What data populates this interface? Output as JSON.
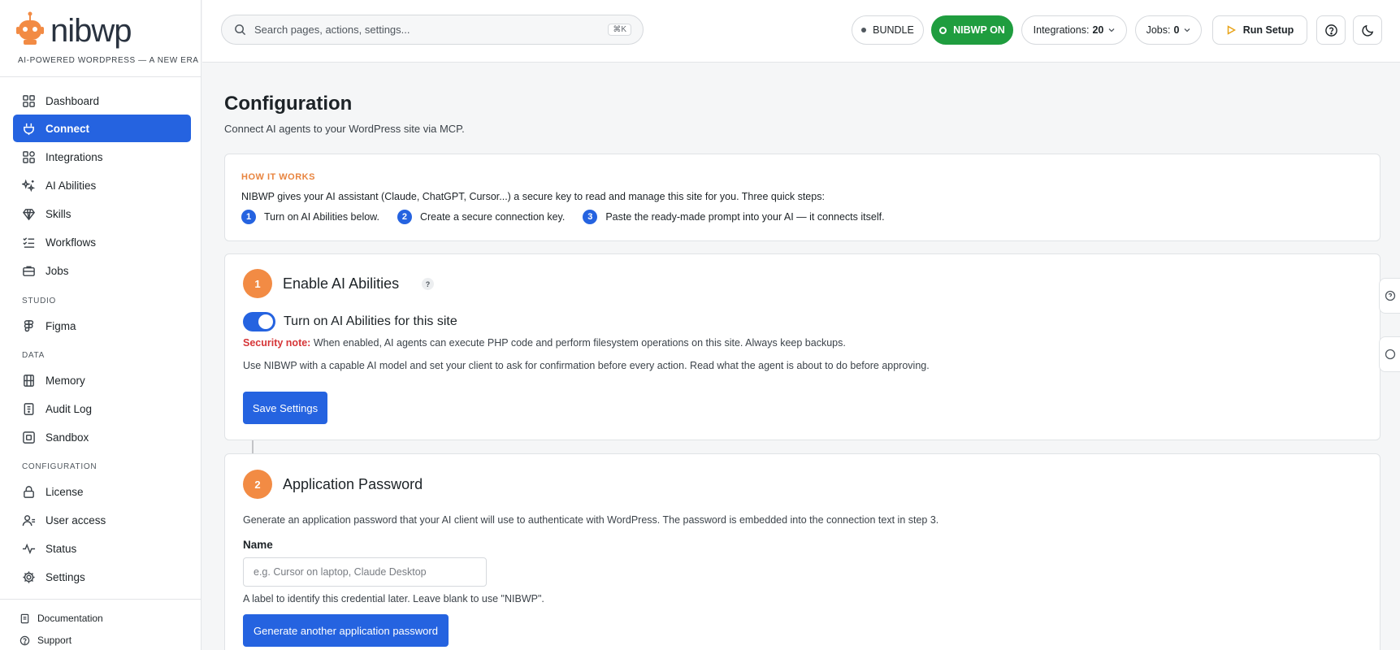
{
  "brand": {
    "name": "nibwp",
    "tagline": "AI-POWERED WORDPRESS — A NEW ERA",
    "accent": "#f28b44"
  },
  "sidebar": {
    "items": [
      {
        "label": "Dashboard",
        "icon": "dashboard-grid-icon"
      },
      {
        "label": "Connect",
        "icon": "plug-icon",
        "active": true
      },
      {
        "label": "Integrations",
        "icon": "integrations-grid-icon"
      },
      {
        "label": "AI Abilities",
        "icon": "sparkle-icon"
      },
      {
        "label": "Skills",
        "icon": "gem-icon"
      },
      {
        "label": "Workflows",
        "icon": "list-checks-icon"
      },
      {
        "label": "Jobs",
        "icon": "briefcase-icon"
      }
    ],
    "studio_label": "STUDIO",
    "studio_items": [
      {
        "label": "Figma",
        "icon": "figma-icon"
      }
    ],
    "data_label": "DATA",
    "data_items": [
      {
        "label": "Memory",
        "icon": "memory-icon"
      },
      {
        "label": "Audit Log",
        "icon": "clipboard-icon"
      },
      {
        "label": "Sandbox",
        "icon": "sandbox-icon"
      }
    ],
    "config_label": "CONFIGURATION",
    "config_items": [
      {
        "label": "License",
        "icon": "lock-icon"
      },
      {
        "label": "User access",
        "icon": "user-access-icon"
      },
      {
        "label": "Status",
        "icon": "activity-icon"
      },
      {
        "label": "Settings",
        "icon": "gear-icon"
      }
    ],
    "footer": [
      {
        "label": "Documentation",
        "icon": "document-icon"
      },
      {
        "label": "Support",
        "icon": "support-icon"
      }
    ],
    "active_color": "#2563e0"
  },
  "topbar": {
    "search_placeholder": "Search pages, actions, settings...",
    "search_shortcut": "⌘K",
    "bundle_label": "BUNDLE",
    "status_label": "NIBWP ON",
    "status_color": "#1f9d3f",
    "integrations_label": "Integrations:",
    "integrations_count": "20",
    "jobs_label": "Jobs:",
    "jobs_count": "0",
    "run_setup_label": "Run Setup"
  },
  "page": {
    "title": "Configuration",
    "subtitle": "Connect AI agents to your WordPress site via MCP."
  },
  "how_it_works": {
    "label": "HOW IT WORKS",
    "text": "NIBWP gives your AI assistant (Claude, ChatGPT, Cursor...) a secure key to read and manage this site for you. Three quick steps:",
    "steps": [
      {
        "num": "1",
        "text": "Turn on AI Abilities below."
      },
      {
        "num": "2",
        "text": "Create a secure connection key."
      },
      {
        "num": "3",
        "text": "Paste the ready-made prompt into your AI — it connects itself."
      }
    ]
  },
  "step1": {
    "num": "1",
    "title": "Enable AI Abilities",
    "help": "?",
    "toggle_label": "Turn on AI Abilities for this site",
    "toggle_on": true,
    "security_prefix": "Security note:",
    "security_text": " When enabled, AI agents can execute PHP code and perform filesystem operations on this site. Always keep backups.",
    "advice": "Use NIBWP with a capable AI model and set your client to ask for confirmation before every action. Read what the agent is about to do before approving.",
    "save_label": "Save Settings"
  },
  "step2": {
    "num": "2",
    "title": "Application Password",
    "description": "Generate an application password that your AI client will use to authenticate with WordPress. The password is embedded into the connection text in step 3.",
    "name_label": "Name",
    "name_placeholder": "e.g. Cursor on laptop, Claude Desktop",
    "name_hint": "A label to identify this credential later. Leave blank to use \"NIBWP\".",
    "generate_label": "Generate another application password"
  }
}
